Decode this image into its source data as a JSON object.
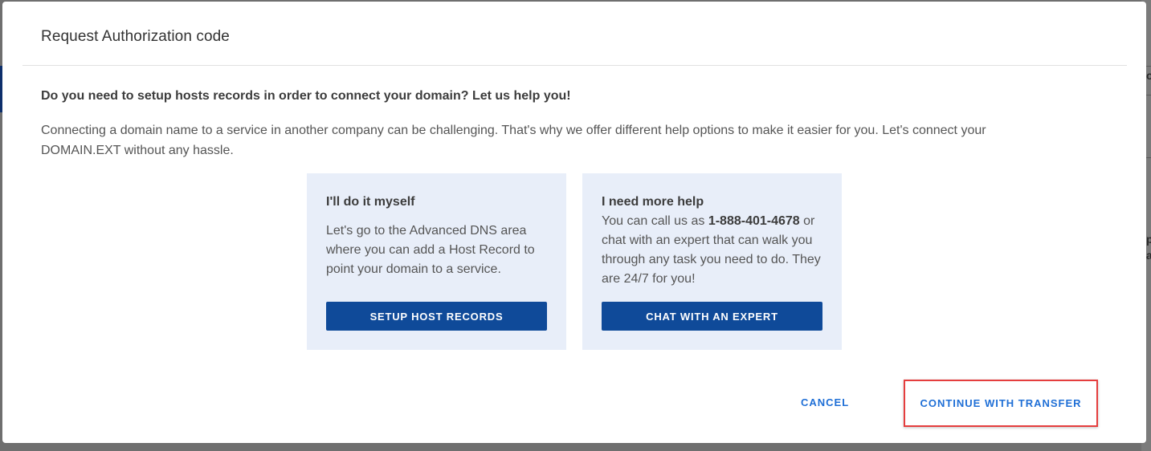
{
  "modal": {
    "title": "Request Authorization code",
    "question": "Do you need to setup hosts records in order to connect your domain? Let us help you!",
    "intro": "Connecting a domain name to a service in another company can be challenging. That's why we offer different help options to make it easier for you. Let's connect your DOMAIN.EXT without any hassle."
  },
  "cards": {
    "self": {
      "title": "I'll do it myself",
      "body": "Let's go to the Advanced DNS area where you can add a Host Record to point your domain to a service.",
      "button_label": "SETUP HOST RECORDS"
    },
    "help": {
      "title": "I need more help",
      "body_before": "You can call us as ",
      "phone": "1-888-401-4678",
      "body_after": " or chat with an expert that can walk you through any task you need to do. They are 24/7 for you!",
      "button_label": "CHAT WITH AN EXPERT"
    }
  },
  "actions": {
    "cancel_label": "CANCEL",
    "continue_label": "CONTINUE WITH TRANSFER"
  },
  "background": {
    "fragment_1": "o",
    "fragment_2": "p",
    "fragment_3": "a"
  },
  "colors": {
    "primary_button": "#0f4a99",
    "link": "#1f6fd6",
    "card_bg": "#e8eef9",
    "highlight_border": "#e53e3e"
  }
}
